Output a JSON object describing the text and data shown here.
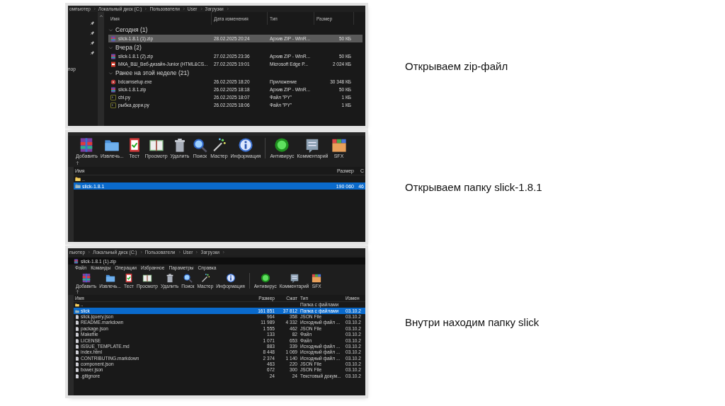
{
  "panels": [
    {
      "kind": "explorer",
      "caption": "Открываем zip-файл",
      "breadcrumb": [
        "омпьютер",
        "Локальный диск (C:)",
        "Пользователи",
        "User",
        "Загрузки"
      ],
      "nav_label": "пор",
      "columns": [
        "Имя",
        "Дата изменения",
        "Тип",
        "Размер"
      ],
      "groups": [
        {
          "label": "Сегодня (1)",
          "expanded": true,
          "rows": [
            {
              "kind": "zip",
              "cells": [
                "slick-1.8.1 (1).zip",
                "28.02.2025 20:24",
                "Архив ZIP - WinR...",
                "50 КБ"
              ],
              "selected": true
            }
          ]
        },
        {
          "label": "Вчера (2)",
          "expanded": true,
          "rows": [
            {
              "kind": "zip",
              "cells": [
                "slick-1.8.1 (2).zip",
                "27.02.2025 23:36",
                "Архив ZIP - WinR...",
                "50 КБ"
              ],
              "selected": false
            },
            {
              "kind": "pdf",
              "cells": [
                "МКА_ВШ_Веб-дизайн-Junior (HTML&CS...",
                "27.02.2025 19:01",
                "Microsoft Edge P...",
                "2 024 КБ"
              ],
              "selected": false
            }
          ]
        },
        {
          "label": "Ранее на этой неделе (21)",
          "expanded": true,
          "rows": [
            {
              "kind": "exe",
              "cells": [
                "bdcamsetup.exe",
                "26.02.2025 18:20",
                "Приложение",
                "30 348 КБ"
              ],
              "selected": false
            },
            {
              "kind": "zip",
              "cells": [
                "slick-1.8.1.zip",
                "26.02.2025 18:18",
                "Архив ZIP - WinR...",
                "50 КБ"
              ],
              "selected": false
            },
            {
              "kind": "py",
              "cells": [
                "cbi.py",
                "26.02.2025 18:07",
                "Файл \"PY\"",
                "1 КБ"
              ],
              "selected": false
            },
            {
              "kind": "py",
              "cells": [
                "рыбка дори.py",
                "26.02.2025 18:06",
                "Файл \"PY\"",
                "1 КБ"
              ],
              "selected": false
            }
          ]
        }
      ]
    },
    {
      "kind": "winrar",
      "caption": "Открываем папку slick-1.8.1",
      "toolbar": [
        {
          "kind": "add",
          "label": "Добавить"
        },
        {
          "kind": "extract",
          "label": "Извлечь..."
        },
        {
          "kind": "test",
          "label": "Тест"
        },
        {
          "kind": "view",
          "label": "Просмотр"
        },
        {
          "kind": "delete",
          "label": "Удалить"
        },
        {
          "kind": "find",
          "label": "Поиск"
        },
        {
          "kind": "wizard",
          "label": "Мастер"
        },
        {
          "kind": "info",
          "label": "Информация"
        },
        {
          "kind": "virus",
          "label": "Антивирус"
        },
        {
          "kind": "comment",
          "label": "Комментарий"
        },
        {
          "kind": "sfx",
          "label": "SFX"
        }
      ],
      "columns": [
        "Имя",
        "Размер",
        "С"
      ],
      "rows": [
        {
          "kind": "folder",
          "cells": [
            "..",
            "",
            ""
          ],
          "selected": false
        },
        {
          "kind": "archfolder",
          "cells": [
            "slick-1.8.1",
            "190 060",
            "46"
          ],
          "selected": true
        }
      ]
    },
    {
      "kind": "winrar",
      "caption": "Внутри находим папку slick",
      "breadcrumb": [
        "пьютер",
        "Локальный диск (C:)",
        "Пользователи",
        "User",
        "Загрузки"
      ],
      "title": "slick-1.8.1 (1).zip",
      "menu": [
        "Файл",
        "Команды",
        "Операции",
        "Избранное",
        "Параметры",
        "Справка"
      ],
      "toolbar": [
        {
          "kind": "add",
          "label": "Добавить"
        },
        {
          "kind": "extract",
          "label": "Извлечь..."
        },
        {
          "kind": "test",
          "label": "Тест"
        },
        {
          "kind": "view",
          "label": "Просмотр"
        },
        {
          "kind": "delete",
          "label": "Удалить"
        },
        {
          "kind": "find",
          "label": "Поиск"
        },
        {
          "kind": "wizard",
          "label": "Мастер"
        },
        {
          "kind": "info",
          "label": "Информация"
        },
        {
          "kind": "virus",
          "label": "Антивирус"
        },
        {
          "kind": "comment",
          "label": "Комментарий"
        },
        {
          "kind": "sfx",
          "label": "SFX"
        }
      ],
      "columns": [
        "Имя",
        "Размер",
        "Сжат",
        "Тип",
        "Измен"
      ],
      "rows": [
        {
          "kind": "folder",
          "cells": [
            "..",
            "",
            "",
            "Папка с файлами",
            ""
          ],
          "selected": false
        },
        {
          "kind": "archfolder",
          "cells": [
            "slick",
            "161 851",
            "37 812",
            "Папка с файлами",
            "03.10.2"
          ],
          "selected": true
        },
        {
          "kind": "file",
          "cells": [
            "slick.jquery.json",
            "964",
            "358",
            "JSON File",
            "03.10.2"
          ],
          "selected": false
        },
        {
          "kind": "file",
          "cells": [
            "README.markdown",
            "11 989",
            "4 332",
            "Исходный файл ...",
            "03.10.2"
          ],
          "selected": false
        },
        {
          "kind": "file",
          "cells": [
            "package.json",
            "1 555",
            "462",
            "JSON File",
            "03.10.2"
          ],
          "selected": false
        },
        {
          "kind": "file",
          "cells": [
            "Makefile",
            "133",
            "82",
            "Файл",
            "03.10.2"
          ],
          "selected": false
        },
        {
          "kind": "file",
          "cells": [
            "LICENSE",
            "1 071",
            "653",
            "Файл",
            "03.10.2"
          ],
          "selected": false
        },
        {
          "kind": "file",
          "cells": [
            "ISSUE_TEMPLATE.md",
            "883",
            "339",
            "Исходный файл ...",
            "03.10.2"
          ],
          "selected": false
        },
        {
          "kind": "file",
          "cells": [
            "index.html",
            "8 448",
            "1 069",
            "Исходный файл ...",
            "03.10.2"
          ],
          "selected": false
        },
        {
          "kind": "file",
          "cells": [
            "CONTRIBUTING.markdown",
            "2 374",
            "1 140",
            "Исходный файл ...",
            "03.10.2"
          ],
          "selected": false
        },
        {
          "kind": "file",
          "cells": [
            "component.json",
            "463",
            "220",
            "JSON File",
            "03.10.2"
          ],
          "selected": false
        },
        {
          "kind": "file",
          "cells": [
            "bower.json",
            "672",
            "300",
            "JSON File",
            "03.10.2"
          ],
          "selected": false
        },
        {
          "kind": "file",
          "cells": [
            ".gitignore",
            "24",
            "24",
            "Текстовый докум...",
            "03.10.2"
          ],
          "selected": false
        }
      ]
    }
  ]
}
